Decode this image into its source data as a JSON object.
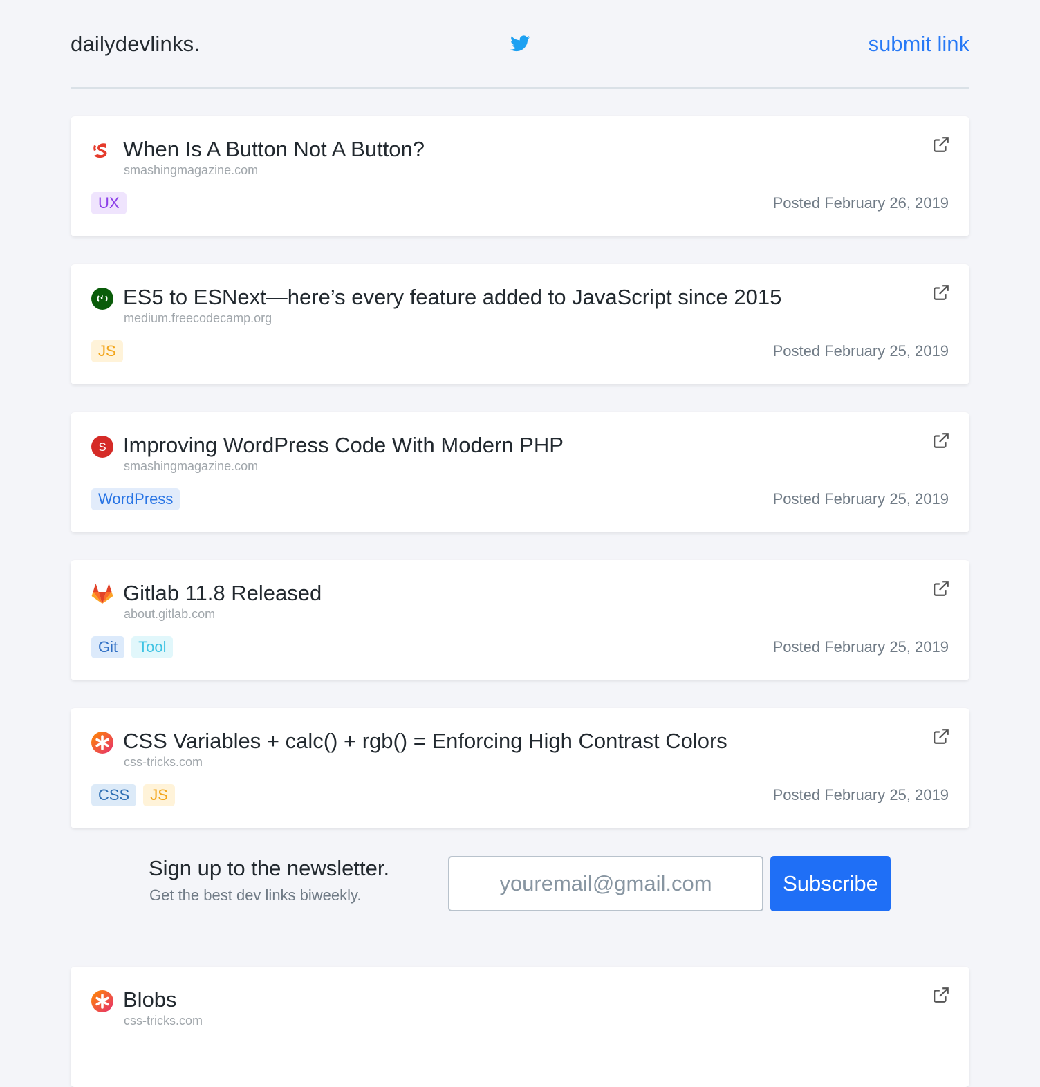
{
  "site": {
    "brand": "dailydevlinks.",
    "submit_label": "submit link"
  },
  "colors": {
    "background": "#f4f5f9",
    "accent": "#2779f6",
    "button": "#1f6ff6"
  },
  "links": [
    {
      "title": "When Is A Button Not A Button?",
      "domain": "smashingmagazine.com",
      "favicon": "smashing-magazine-icon",
      "tags": [
        "UX"
      ],
      "posted": "Posted February 26, 2019"
    },
    {
      "title": "ES5 to ESNext—here’s every feature added to JavaScript since 2015",
      "domain": "medium.freecodecamp.org",
      "favicon": "freecodecamp-icon",
      "tags": [
        "JS"
      ],
      "posted": "Posted February 25, 2019"
    },
    {
      "title": "Improving WordPress Code With Modern PHP",
      "domain": "smashingmagazine.com",
      "favicon": "smashing-circle-icon",
      "tags": [
        "WordPress"
      ],
      "posted": "Posted February 25, 2019"
    },
    {
      "title": "Gitlab 11.8 Released",
      "domain": "about.gitlab.com",
      "favicon": "gitlab-icon",
      "tags": [
        "Git",
        "Tool"
      ],
      "posted": "Posted February 25, 2019"
    },
    {
      "title": "CSS Variables + calc() + rgb() = Enforcing High Contrast Colors",
      "domain": "css-tricks.com",
      "favicon": "css-tricks-icon",
      "tags": [
        "CSS",
        "JS"
      ],
      "posted": "Posted February 25, 2019"
    }
  ],
  "newsletter": {
    "heading": "Sign up to the newsletter.",
    "subheading": "Get the best dev links biweekly.",
    "placeholder": "youremail@gmail.com",
    "button_label": "Subscribe"
  },
  "more_links": [
    {
      "title": "Blobs",
      "domain": "css-tricks.com",
      "favicon": "css-tricks-icon"
    }
  ]
}
